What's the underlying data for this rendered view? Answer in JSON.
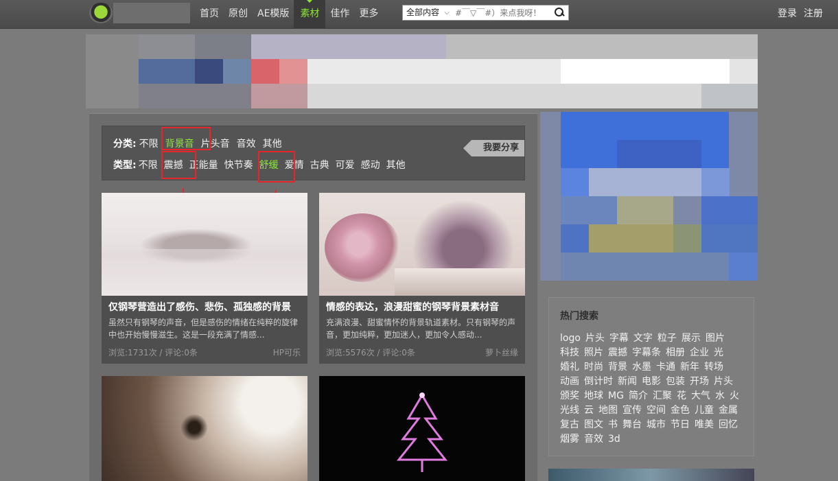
{
  "nav": {
    "items": [
      "首页",
      "原创",
      "AE模版",
      "素材",
      "佳作",
      "更多"
    ],
    "active_index": 3
  },
  "search": {
    "scope": "全部内容",
    "placeholder": "#￣▽￣#）来点我呀！"
  },
  "auth": {
    "login": "登录",
    "register": "注册"
  },
  "filter": {
    "category_label": "分类:",
    "categories": [
      "不限",
      "背景音",
      "片头音",
      "音效",
      "其他"
    ],
    "category_selected": 1,
    "type_label": "类型:",
    "types": [
      "不限",
      "震撼",
      "正能量",
      "快节奏",
      "舒缓",
      "爱情",
      "古典",
      "可爱",
      "感动",
      "其他"
    ],
    "type_selected": 4,
    "share_button": "我要分享"
  },
  "cards": [
    {
      "title": "仅钢琴营造出了感伤、悲伤、孤独感的背景",
      "desc": "虽然只有钢琴的声音，但是感伤的情绪在纯粹的旋律中也开始慢慢滋生。这是一段充满了情感...",
      "stats": "浏览:1731次 / 评论:0条",
      "author": "HP可乐"
    },
    {
      "title": "情感的表达，浪漫甜蜜的钢琴背景素材音",
      "desc": "充满浪漫、甜蜜情怀的背景轨道素材。只有钢琴的声音，更加纯粹，更加迷人，更加令人感动...",
      "stats": "浏览:5576次 / 评论:0条",
      "author": "萝卜丝缘"
    }
  ],
  "hot_search": {
    "title": "热门搜索",
    "tags": [
      "logo",
      "片头",
      "字幕",
      "文字",
      "粒子",
      "展示",
      "图片",
      "科技",
      "照片",
      "震撼",
      "字幕条",
      "相册",
      "企业",
      "光",
      "婚礼",
      "时尚",
      "背景",
      "水墨",
      "卡通",
      "新年",
      "转场",
      "动画",
      "倒计时",
      "新闻",
      "电影",
      "包装",
      "开场",
      "片头",
      "颁奖",
      "地球",
      "MG",
      "简介",
      "汇聚",
      "花",
      "大气",
      "水",
      "火",
      "光线",
      "云",
      "地图",
      "宣传",
      "空间",
      "金色",
      "儿童",
      "金属",
      "复古",
      "图文",
      "书",
      "舞台",
      "城市",
      "节日",
      "唯美",
      "回忆",
      "烟雾",
      "音效",
      "3d"
    ]
  }
}
